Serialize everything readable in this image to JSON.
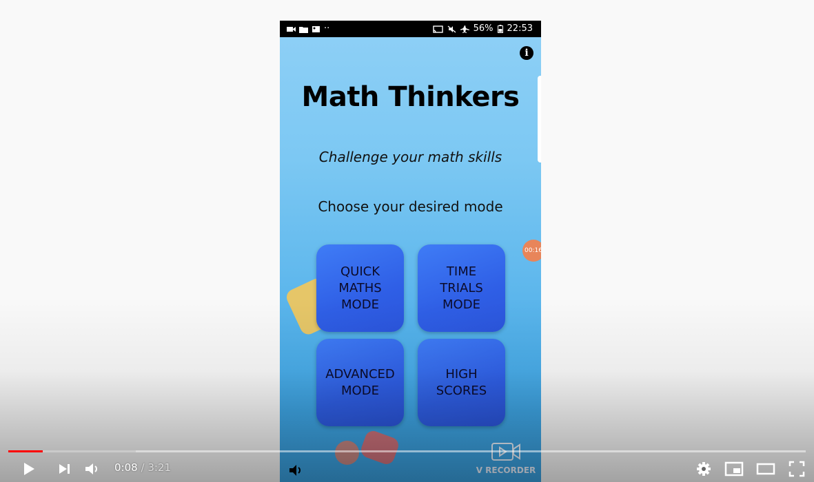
{
  "phone": {
    "status_bar": {
      "battery": "56%",
      "clock": "22:53",
      "dots": "··"
    },
    "app_title": "Math Thinkers",
    "subtitle": "Challenge your math skills",
    "prompt": "Choose your desired mode",
    "modes": [
      {
        "label": "QUICK MATHS MODE"
      },
      {
        "label": "TIME TRIALS MODE"
      },
      {
        "label": "ADVANCED MODE"
      },
      {
        "label": "HIGH SCORES"
      }
    ],
    "recorder_timer": "00:16",
    "recorder_label": "V RECORDER",
    "info_glyph": "i"
  },
  "player": {
    "current_time": "0:08",
    "separator": "/",
    "duration": "3:21",
    "progress": 0.043,
    "buffered": 0.16,
    "accent_color": "#ff0000",
    "icons": [
      "play-icon",
      "next-icon",
      "volume-icon",
      "settings-icon",
      "miniplayer-icon",
      "theater-icon",
      "fullscreen-icon"
    ]
  }
}
